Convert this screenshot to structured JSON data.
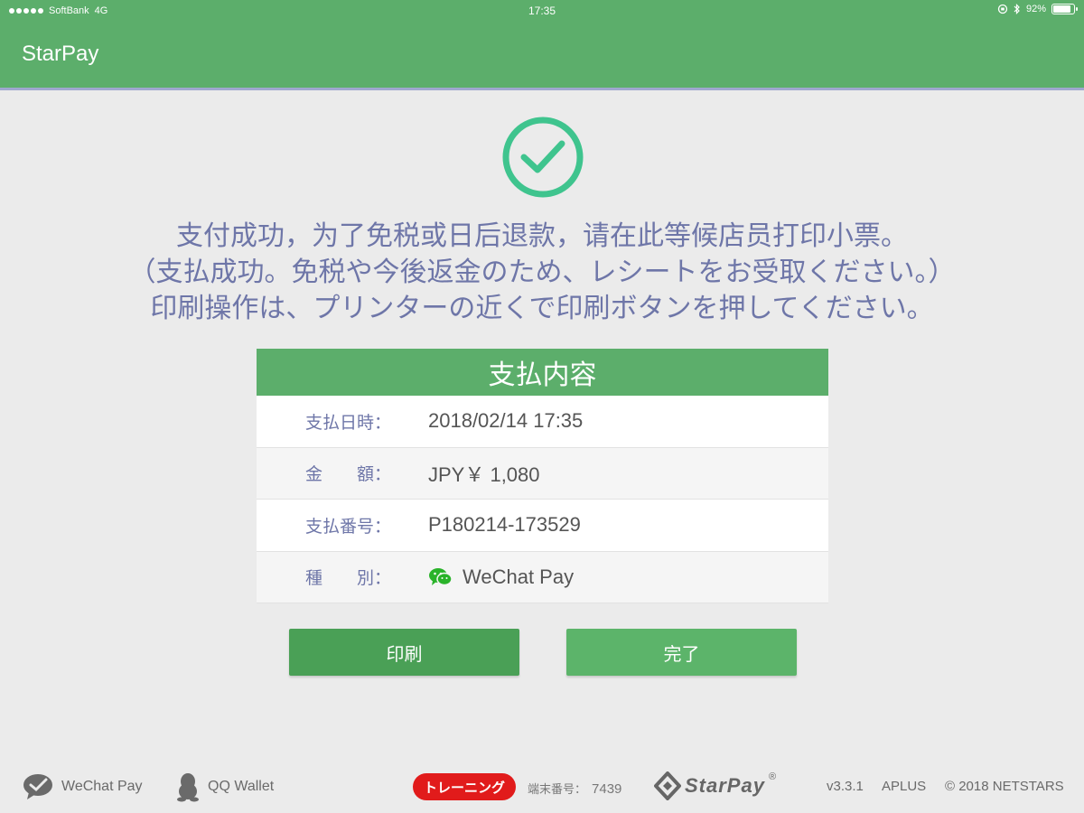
{
  "status_bar": {
    "carrier": "SoftBank",
    "network": "4G",
    "time": "17:35",
    "battery": "92%",
    "battery_level": 0.92
  },
  "header": {
    "app_title": "StarPay"
  },
  "messages": [
    "支付成功，为了免税或日后退款，请在此等候店员打印小票。",
    "（支払成功。免税や今後返金のため、レシートをお受取ください。）",
    "印刷操作は、プリンターの近くで印刷ボタンを押してください。"
  ],
  "details": {
    "title": "支払内容",
    "rows": [
      {
        "label": "支払日時：",
        "value": "2018/02/14 17:35"
      },
      {
        "label": "金　　額：",
        "value": "JPY￥ 1,080"
      },
      {
        "label": "支払番号：",
        "value": "P180214-173529"
      },
      {
        "label": "種　　別：",
        "value": "WeChat Pay",
        "icon": "wechat-icon"
      }
    ]
  },
  "buttons": {
    "print": "印刷",
    "done": "完了"
  },
  "footer": {
    "wechat_pay": "WeChat Pay",
    "qq_wallet": "QQ Wallet",
    "training": "トレーニング",
    "terminal_label": "端末番号：",
    "terminal_number": "7439",
    "logo_text": "StarPay",
    "version": "v3.3.1",
    "aplus": "APLUS",
    "copyright": "© 2018 NETSTARS"
  },
  "colors": {
    "brand_green": "#5cae6b",
    "check_green": "#3fc48e",
    "text_purple": "#6e76a8",
    "training_red": "#e11b1b"
  }
}
